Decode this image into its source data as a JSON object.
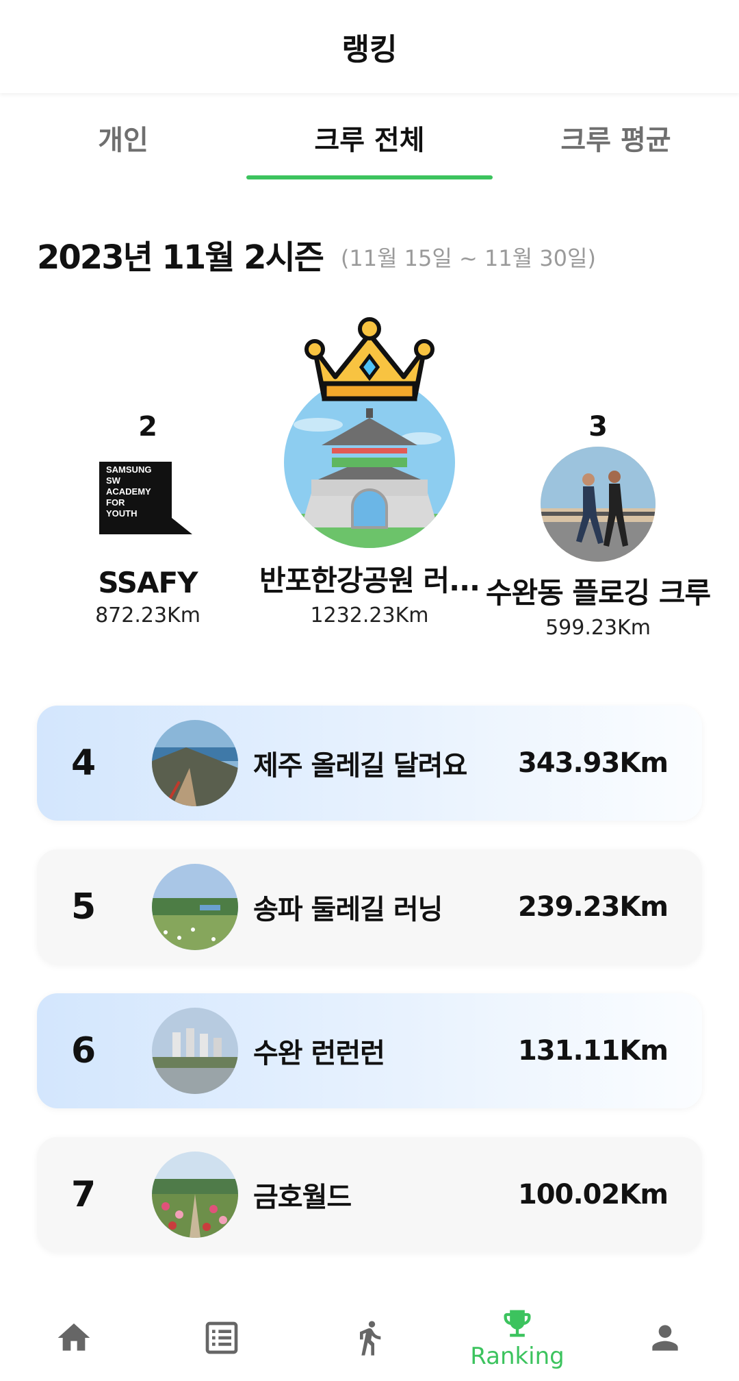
{
  "header": {
    "title": "랭킹"
  },
  "tabs": [
    {
      "label": "개인",
      "active": false
    },
    {
      "label": "크루 전체",
      "active": true
    },
    {
      "label": "크루 평균",
      "active": false
    }
  ],
  "season": {
    "title": "2023년 11월 2시즌",
    "range": "(11월 15일 ~ 11월 30일)"
  },
  "podium": {
    "first": {
      "rank": "1",
      "name": "반포한강공원 러...",
      "distance": "1232.23Km",
      "icon": "crown-icon"
    },
    "second": {
      "rank": "2",
      "name": "SSAFY",
      "distance": "872.23Km",
      "logo_text": [
        "SAMSUNG",
        "SW",
        "ACADEMY",
        "FOR",
        "YOUTH"
      ]
    },
    "third": {
      "rank": "3",
      "name": "수완동 플로깅 크루",
      "distance": "599.23Km"
    }
  },
  "ranking_list": [
    {
      "rank": "4",
      "name": "제주 올레길 달려요",
      "distance": "343.93Km"
    },
    {
      "rank": "5",
      "name": "송파 둘레길 러닝",
      "distance": "239.23Km"
    },
    {
      "rank": "6",
      "name": "수완 런런런",
      "distance": "131.11Km"
    },
    {
      "rank": "7",
      "name": "금호월드",
      "distance": "100.02Km"
    }
  ],
  "bottom_nav": {
    "items": [
      {
        "icon": "home-icon",
        "label": ""
      },
      {
        "icon": "list-icon",
        "label": ""
      },
      {
        "icon": "walk-icon",
        "label": ""
      },
      {
        "icon": "trophy-icon",
        "label": "Ranking",
        "active": true
      },
      {
        "icon": "person-icon",
        "label": ""
      }
    ]
  },
  "colors": {
    "accent": "#3cc35e",
    "highlight": "#7af0a0",
    "row_blue": "#d3e6fd",
    "row_gray": "#f7f7f7"
  }
}
